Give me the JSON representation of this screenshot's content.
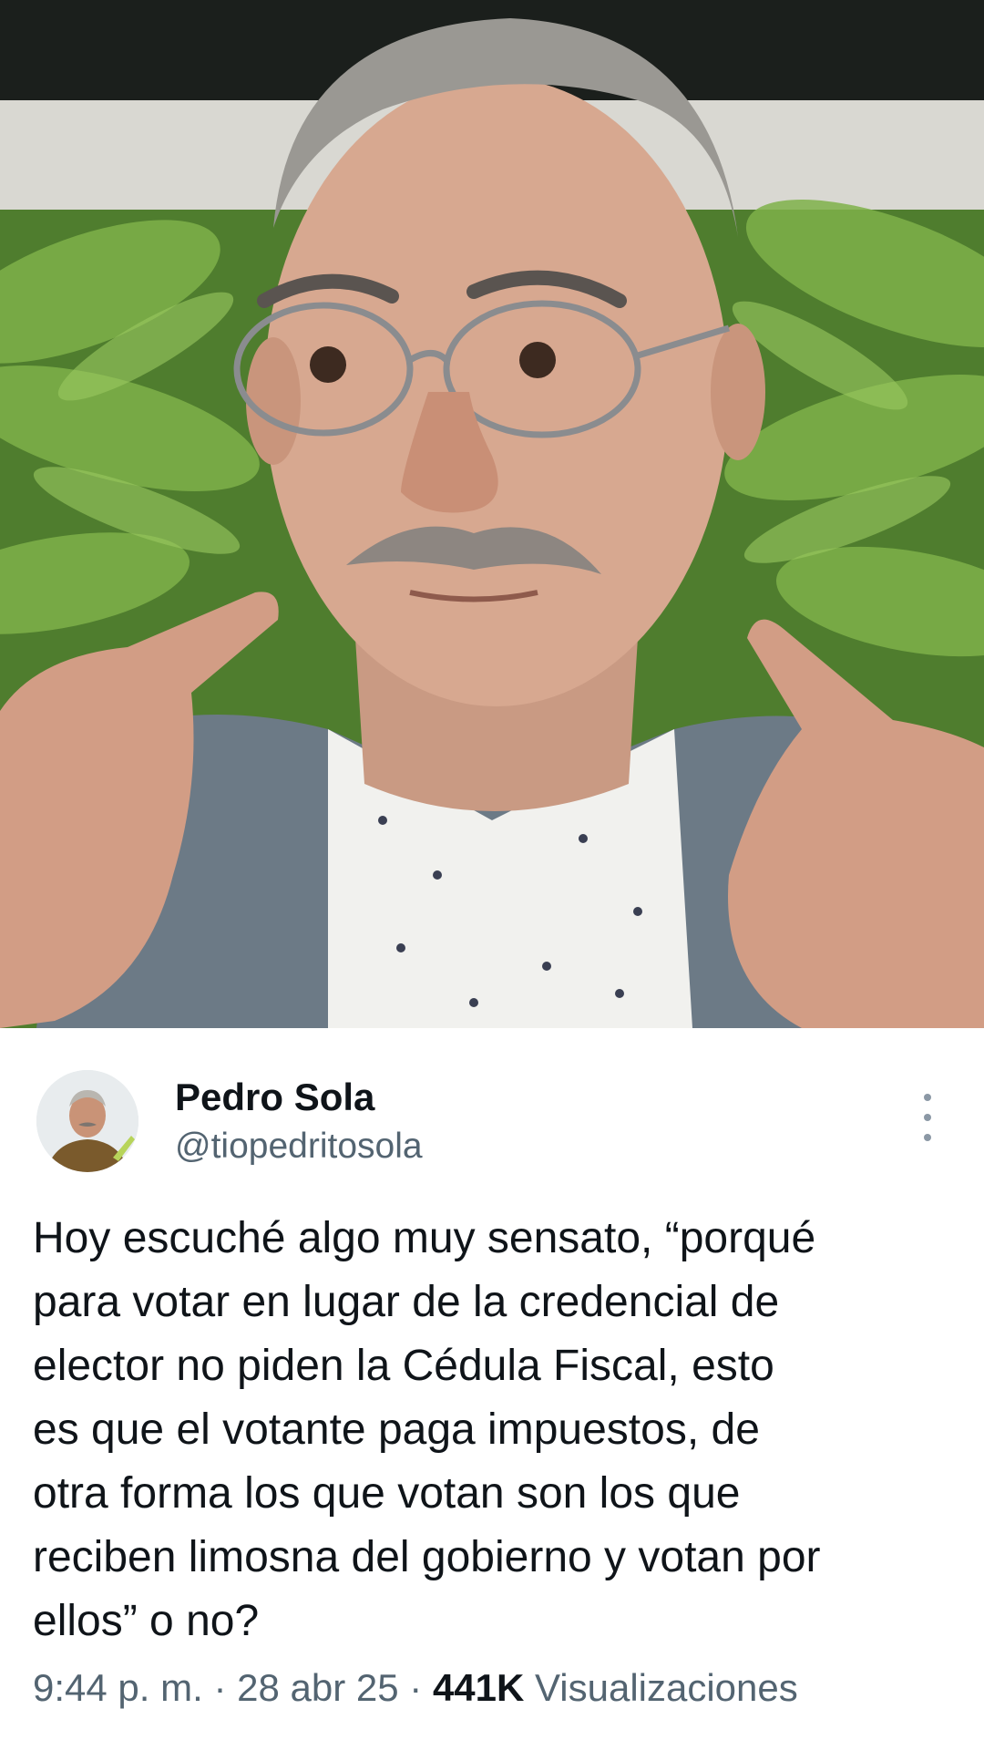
{
  "post": {
    "author_name": "Pedro Sola",
    "author_handle": "@tiopedritosola",
    "text": "Hoy escuché algo muy sensato, “porqué\npara votar en lugar de la credencial de\nelector no piden la Cédula Fiscal, esto\nes que el votante paga impuestos, de\notra forma los que votan son los que\nreciben limosna del gobierno y votan por\nellos” o no?",
    "time": "9:44 p. m.",
    "separator": "·",
    "date": "28 abr 25",
    "views_count": "441K",
    "views_label": "Visualizaciones"
  },
  "icons": {
    "more": "more-vertical-icon"
  },
  "colors": {
    "text_primary": "#0f1419",
    "text_secondary": "#536471",
    "more_icon": "#8b98a5",
    "background": "#ffffff"
  }
}
